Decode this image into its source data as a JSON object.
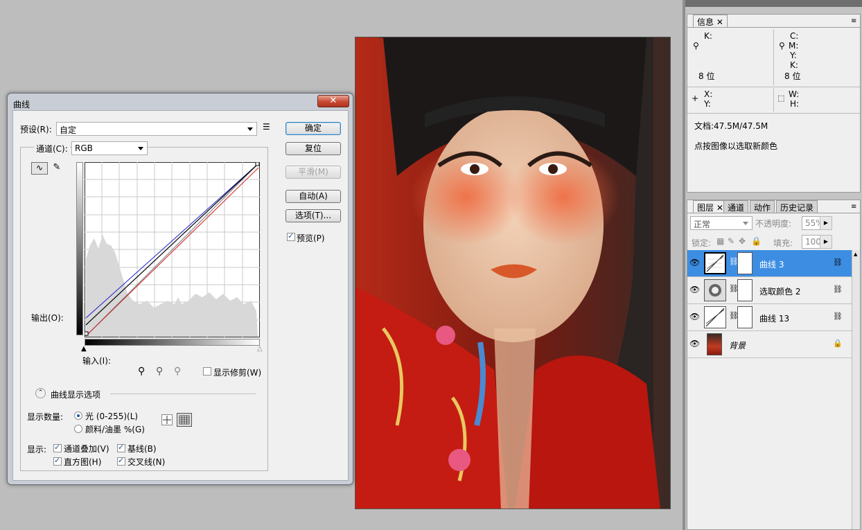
{
  "curves_dialog": {
    "title": "曲线",
    "close": "✕",
    "preset_label": "预设(R):",
    "preset_value": "自定",
    "channel_label": "通道(C):",
    "channel_value": "RGB",
    "output_label": "输出(O):",
    "input_label": "输入(I):",
    "show_clipping": "显示修剪(W)",
    "display_options": "曲线显示选项",
    "show_amount_label": "显示数量:",
    "light_option": "光 (0-255)(L)",
    "pigment_option": "颜料/油墨 %(G)",
    "show_label": "显示:",
    "channel_overlay": "通道叠加(V)",
    "baseline": "基线(B)",
    "histogram": "直方图(H)",
    "intersection": "交叉线(N)",
    "buttons": {
      "ok": "确定",
      "reset": "复位",
      "smooth": "平滑(M)",
      "auto": "自动(A)",
      "options": "选项(T)...",
      "preview": "预览(P)"
    },
    "curve_colors": {
      "rgb": "#000000",
      "red": "#d02020",
      "blue": "#2020d0"
    }
  },
  "info_panel": {
    "tab": "信息",
    "k_label": "K:",
    "c_label": "C:",
    "m_label": "M:",
    "y_label": "Y:",
    "k2_label": "K:",
    "bits_left": "8 位",
    "bits_right": "8 位",
    "x_label": "X:",
    "y2_label": "Y:",
    "w_label": "W:",
    "h_label": "H:",
    "doc": "文档:47.5M/47.5M",
    "hint": "点按图像以选取新颜色"
  },
  "layers_panel": {
    "tabs": [
      "图层",
      "通道",
      "动作",
      "历史记录"
    ],
    "blend_mode": "正常",
    "opacity_label": "不透明度:",
    "opacity_value": "55%",
    "lock_label": "锁定:",
    "fill_label": "填充:",
    "fill_value": "100%",
    "layers": [
      {
        "name": "曲线 3",
        "selected": true
      },
      {
        "name": "选取颜色 2",
        "selected": false
      },
      {
        "name": "曲线 13",
        "selected": false
      },
      {
        "name": "背景",
        "selected": false
      }
    ]
  }
}
